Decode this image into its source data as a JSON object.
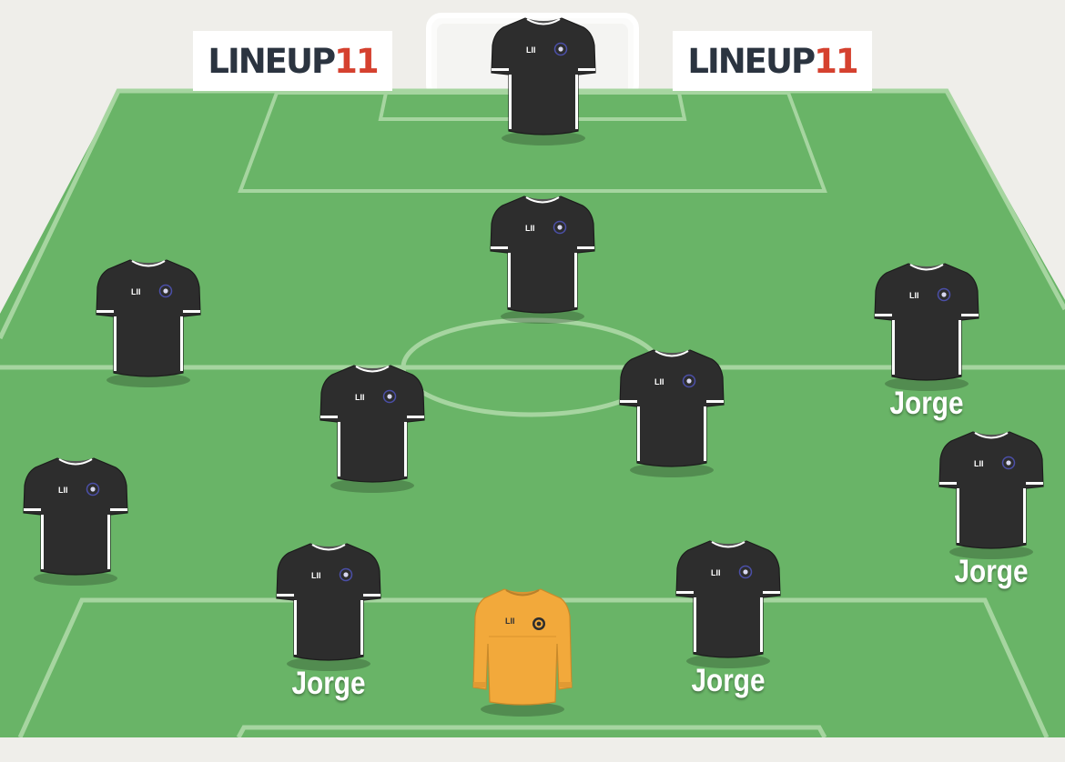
{
  "brand": {
    "word": "LINEUP",
    "number": "11"
  },
  "colors": {
    "pitch": "#69b467",
    "pitch_lines": "#a6d5a0",
    "background": "#efeeea",
    "shirt_outfield": "#2d2d2d",
    "shirt_keeper": "#f2a93b",
    "shirt_trim": "#ffffff",
    "crest": "#4b4fa8"
  },
  "shirt_logo": "LII",
  "players": [
    {
      "role": "outfield",
      "name": ""
    },
    {
      "role": "outfield",
      "name": ""
    },
    {
      "role": "outfield",
      "name": ""
    },
    {
      "role": "outfield",
      "name": "Jorge"
    },
    {
      "role": "outfield",
      "name": ""
    },
    {
      "role": "outfield",
      "name": ""
    },
    {
      "role": "outfield",
      "name": ""
    },
    {
      "role": "outfield",
      "name": "Jorge"
    },
    {
      "role": "outfield",
      "name": "Jorge"
    },
    {
      "role": "outfield",
      "name": "Jorge"
    },
    {
      "role": "goalkeeper",
      "name": ""
    }
  ]
}
